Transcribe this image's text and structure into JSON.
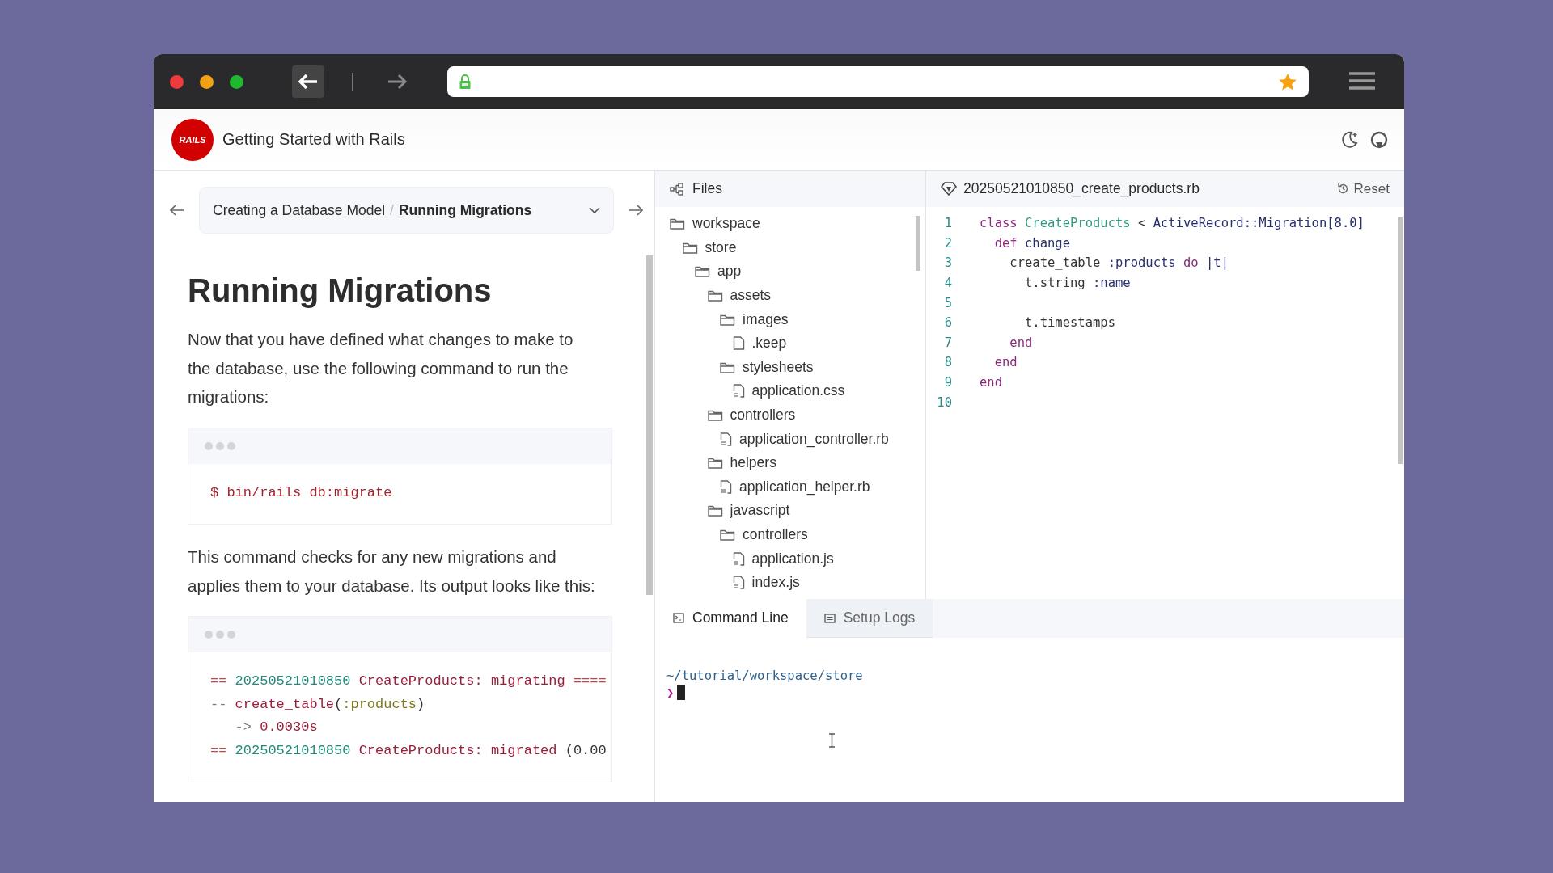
{
  "app_header": {
    "logo_text": "RAILS",
    "title": "Getting Started with Rails"
  },
  "guide": {
    "breadcrumb": {
      "parent": "Creating a Database Model",
      "separator": "/",
      "current": "Running Migrations"
    },
    "heading": "Running Migrations",
    "blocks": [
      {
        "kind": "paragraph",
        "text": "Now that you have defined what changes to make to the database, use the following command to run the migrations:"
      },
      {
        "kind": "code",
        "lines": [
          [
            {
              "text": "$ bin/rails db:migrate",
              "kind": "cmd"
            }
          ]
        ]
      },
      {
        "kind": "paragraph",
        "text": "This command checks for any new migrations and applies them to your database. Its output looks like this:"
      },
      {
        "kind": "code",
        "lines": [
          [
            {
              "text": "== ",
              "kind": "op"
            },
            {
              "text": "20250521010850",
              "kind": "num"
            },
            {
              "text": " CreateProducts: ",
              "kind": "str"
            },
            {
              "text": "migrating",
              "kind": "str"
            },
            {
              "text": " ====",
              "kind": "op"
            }
          ],
          [
            {
              "text": "-- ",
              "kind": "dim"
            },
            {
              "text": "create_table",
              "kind": "str"
            },
            {
              "text": "(",
              "kind": "plain"
            },
            {
              "text": ":products",
              "kind": "sym"
            },
            {
              "text": ")",
              "kind": "plain"
            }
          ],
          [
            {
              "text": "   -> ",
              "kind": "dim"
            },
            {
              "text": "0.0030s",
              "kind": "str"
            }
          ],
          [
            {
              "text": "== ",
              "kind": "op"
            },
            {
              "text": "20250521010850",
              "kind": "num"
            },
            {
              "text": " CreateProducts: ",
              "kind": "str"
            },
            {
              "text": "migrated",
              "kind": "str"
            },
            {
              "text": " (0.00",
              "kind": "plain"
            }
          ]
        ]
      }
    ]
  },
  "files": {
    "title": "Files",
    "tree": [
      {
        "name": "workspace",
        "kind": "folder",
        "children": [
          {
            "name": "store",
            "kind": "folder",
            "children": [
              {
                "name": "app",
                "kind": "folder",
                "children": [
                  {
                    "name": "assets",
                    "kind": "folder",
                    "children": [
                      {
                        "name": "images",
                        "kind": "folder",
                        "children": [
                          {
                            "name": ".keep",
                            "kind": "file"
                          }
                        ]
                      },
                      {
                        "name": "stylesheets",
                        "kind": "folder",
                        "children": [
                          {
                            "name": "application.css",
                            "kind": "code-file"
                          }
                        ]
                      }
                    ]
                  },
                  {
                    "name": "controllers",
                    "kind": "folder",
                    "children": [
                      {
                        "name": "application_controller.rb",
                        "kind": "code-file"
                      }
                    ]
                  },
                  {
                    "name": "helpers",
                    "kind": "folder",
                    "children": [
                      {
                        "name": "application_helper.rb",
                        "kind": "code-file"
                      }
                    ]
                  },
                  {
                    "name": "javascript",
                    "kind": "folder",
                    "children": [
                      {
                        "name": "controllers",
                        "kind": "folder",
                        "children": [
                          {
                            "name": "application.js",
                            "kind": "code-file"
                          },
                          {
                            "name": "index.js",
                            "kind": "code-file"
                          }
                        ]
                      }
                    ]
                  }
                ]
              }
            ]
          }
        ]
      }
    ]
  },
  "editor": {
    "filename": "20250521010850_create_products.rb",
    "reset": "Reset",
    "lines": [
      {
        "number": "1",
        "tokens": [
          {
            "text": "class ",
            "kind": "kw"
          },
          {
            "text": "CreateProducts",
            "kind": "const"
          },
          {
            "text": " < ",
            "kind": "plain"
          },
          {
            "text": "ActiveRecord::Migration[8.0]",
            "kind": "name"
          }
        ]
      },
      {
        "number": "2",
        "tokens": [
          {
            "text": "  def ",
            "kind": "kw"
          },
          {
            "text": "change",
            "kind": "name"
          }
        ]
      },
      {
        "number": "3",
        "tokens": [
          {
            "text": "    create_table ",
            "kind": "plain"
          },
          {
            "text": ":products",
            "kind": "name"
          },
          {
            "text": " do ",
            "kind": "kw"
          },
          {
            "text": "|t|",
            "kind": "name"
          }
        ]
      },
      {
        "number": "4",
        "tokens": [
          {
            "text": "      t.string ",
            "kind": "plain"
          },
          {
            "text": ":name",
            "kind": "name"
          }
        ]
      },
      {
        "number": "5"
      },
      {
        "number": "6",
        "tokens": [
          {
            "text": "      t.timestamps",
            "kind": "plain"
          }
        ]
      },
      {
        "number": "7",
        "tokens": [
          {
            "text": "    end",
            "kind": "kw"
          }
        ]
      },
      {
        "number": "8",
        "tokens": [
          {
            "text": "  end",
            "kind": "kw"
          }
        ]
      },
      {
        "number": "9",
        "tokens": [
          {
            "text": "end",
            "kind": "kw"
          }
        ]
      },
      {
        "number": "10"
      }
    ]
  },
  "terminal": {
    "tabs": [
      {
        "label": "Command Line",
        "kind": "terminal",
        "selected": true
      },
      {
        "label": "Setup Logs",
        "kind": "logs",
        "selected": false
      }
    ],
    "path": "~/tutorial/workspace/store",
    "prompt": "❯"
  }
}
